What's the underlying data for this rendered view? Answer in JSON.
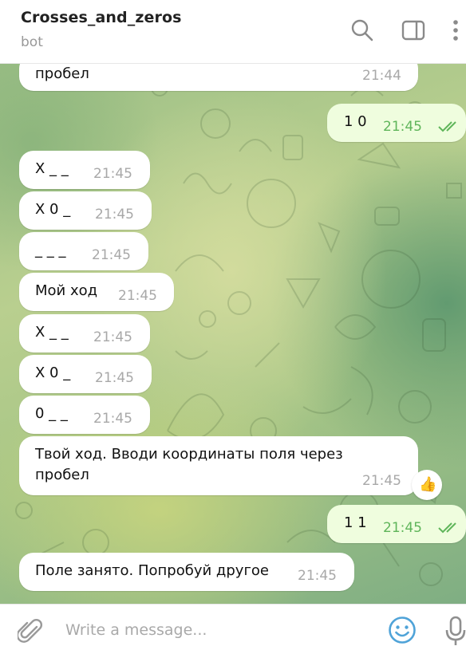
{
  "header": {
    "title": "Crosses_and_zeros",
    "subtitle": "bot"
  },
  "messages": [
    {
      "text": "пробел",
      "time": "21:44"
    },
    {
      "text": "1 0",
      "time": "21:45"
    },
    {
      "text": "X _ _",
      "time": "21:45"
    },
    {
      "text": "X 0 _",
      "time": "21:45"
    },
    {
      "text": "_ _ _",
      "time": "21:45"
    },
    {
      "text": "Мой ход",
      "time": "21:45"
    },
    {
      "text": "X _ _",
      "time": "21:45"
    },
    {
      "text": "X 0 _",
      "time": "21:45"
    },
    {
      "text": "0 _ _",
      "time": "21:45"
    },
    {
      "text_line1": "Твой ход. Вводи координаты поля через",
      "text_line2": "пробел",
      "time": "21:45",
      "reaction": "👍"
    },
    {
      "text": "1 1",
      "time": "21:45"
    },
    {
      "text": "Поле занято. Попробуй другое",
      "time": "21:45"
    }
  ],
  "composer": {
    "placeholder": "Write a message..."
  },
  "colors": {
    "accent": "#4fa3d8",
    "outgoing_bubble": "#effdde",
    "outgoing_time": "#5fb55a"
  },
  "icons": [
    "search-icon",
    "sidebar-toggle-icon",
    "more-vertical-icon",
    "paperclip-icon",
    "emoji-icon",
    "microphone-icon",
    "double-check-icon"
  ]
}
